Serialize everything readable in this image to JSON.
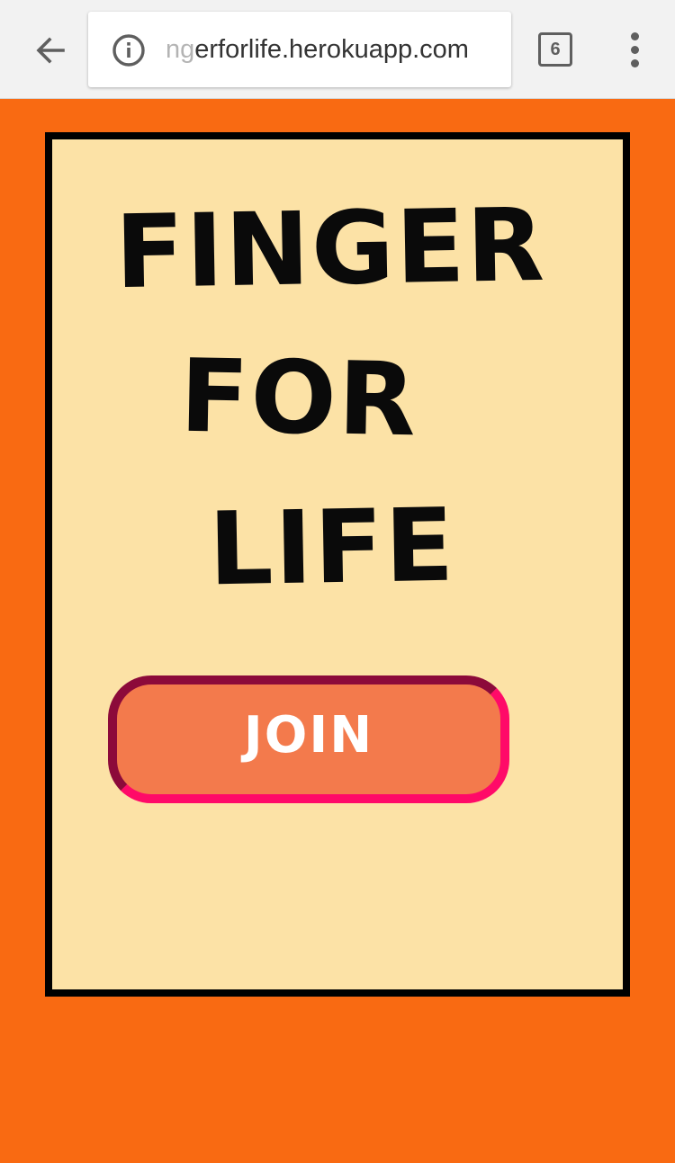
{
  "browser": {
    "back_icon": "arrow-left-icon",
    "info_icon": "info-icon",
    "url_faded": "ng",
    "url_main": "erforlife.herokuapp.com",
    "tab_count": "6",
    "menu_icon": "more-vertical-icon"
  },
  "card": {
    "title_line_1": "FINGER",
    "title_line_2": "FOR",
    "title_line_3": "LIFE",
    "join_label": "JOIN"
  },
  "colors": {
    "page_background": "#f96a12",
    "card_background": "#fce2a6",
    "card_border": "#000000",
    "button_fill": "#f37a4c",
    "button_border": "#ff0a68",
    "button_border_shadow": "#8c0a3a"
  }
}
